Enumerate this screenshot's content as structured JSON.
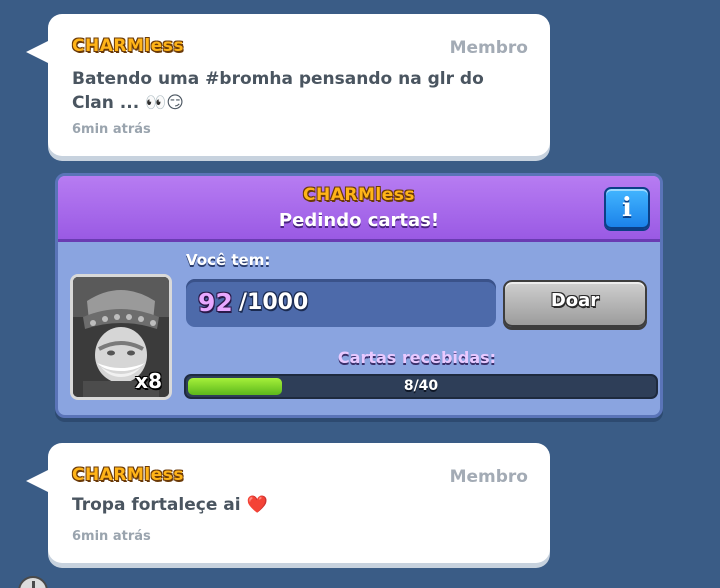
{
  "messages": [
    {
      "author": "CHARMless",
      "role": "Membro",
      "text": "Batendo uma #bromha pensando na glr do Clan ... 👀😏",
      "time": "6min atrás"
    },
    {
      "author": "CHARMless",
      "role": "Membro",
      "text": "Tropa fortaleçe ai ❤️",
      "time": "6min atrás"
    }
  ],
  "request": {
    "author": "CHARMless",
    "title": "Pedindo cartas!",
    "info_icon": "info-icon",
    "card_count": "x8",
    "you_have_label": "Você tem:",
    "have_count": "92",
    "have_max": "/1000",
    "donate_label": "Doar",
    "received_label": "Cartas recebidas:",
    "received_text": "8/40",
    "received_value": 8,
    "received_max": 40
  },
  "colors": {
    "background": "#3a5c86",
    "header_purple": "#9a5ae4",
    "card_body": "#8aa4e0",
    "progress_green": "#5cb81c",
    "name_gold": "#ffb418"
  }
}
